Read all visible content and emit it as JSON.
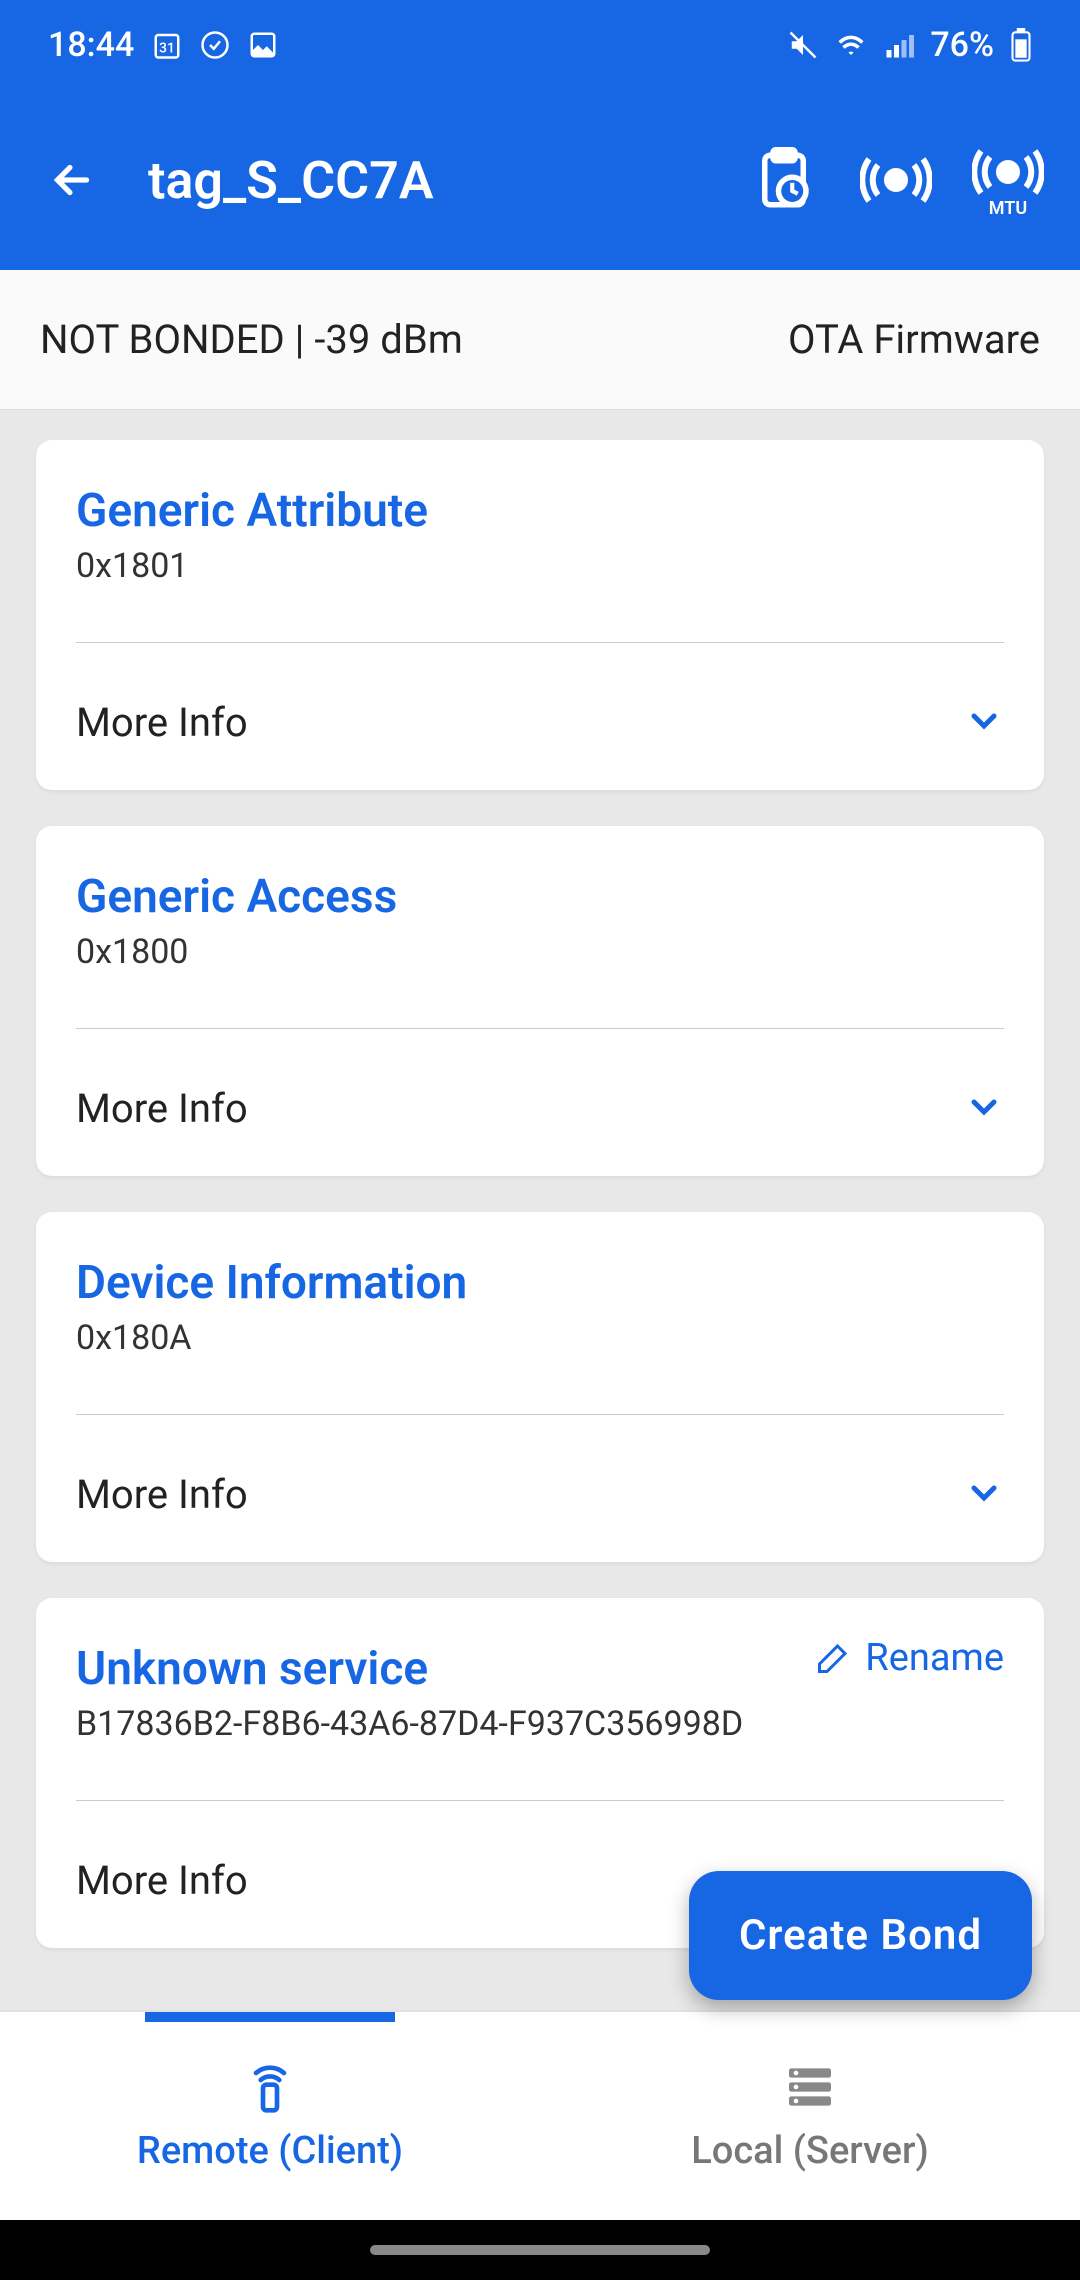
{
  "statusbar": {
    "time": "18:44",
    "battery_pct": "76%"
  },
  "appbar": {
    "title": "tag_S_CC7A"
  },
  "subheader": {
    "left": "NOT BONDED | -39 dBm",
    "right": "OTA Firmware"
  },
  "services": [
    {
      "name": "Generic Attribute",
      "uuid": "0x1801",
      "more_info": "More Info",
      "rename": null
    },
    {
      "name": "Generic Access",
      "uuid": "0x1800",
      "more_info": "More Info",
      "rename": null
    },
    {
      "name": "Device Information",
      "uuid": "0x180A",
      "more_info": "More Info",
      "rename": null
    },
    {
      "name": "Unknown service",
      "uuid": "B17836B2-F8B6-43A6-87D4-F937C356998D",
      "more_info": "More Info",
      "rename": "Rename"
    }
  ],
  "fab": {
    "label": "Create Bond"
  },
  "bottomnav": {
    "remote": "Remote (Client)",
    "local": "Local (Server)"
  }
}
